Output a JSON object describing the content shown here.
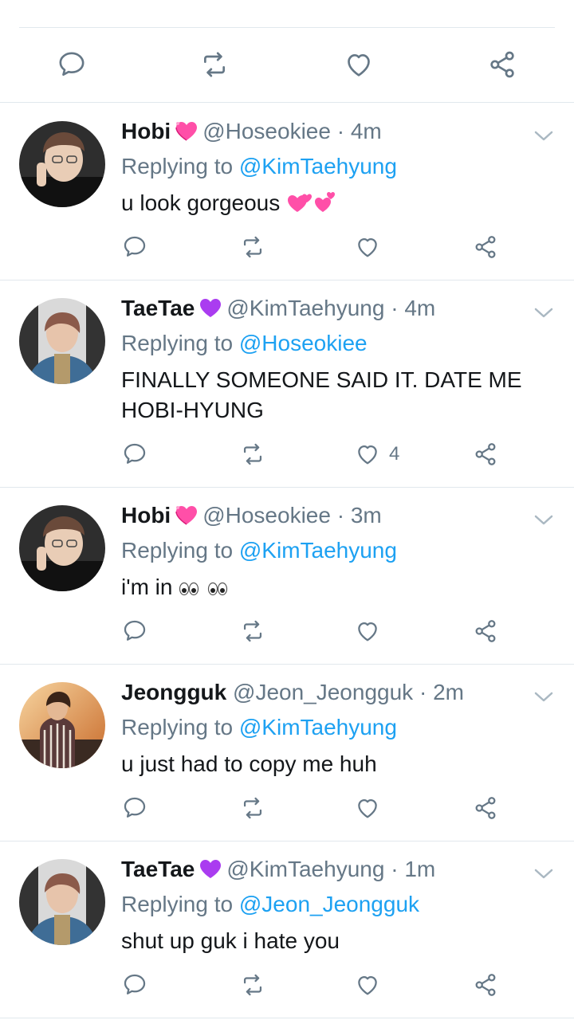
{
  "tweets": [
    {
      "name": "Hobi",
      "name_emoji": "heart-sparkle",
      "handle": "@Hoseokiee",
      "dot": "·",
      "time": "4m",
      "reply_prefix": "Replying to",
      "reply_to": "@KimTaehyung",
      "text": "u look gorgeous",
      "text_emoji": "two-hearts",
      "likes": ""
    },
    {
      "name": "TaeTae",
      "name_emoji": "purple-heart",
      "handle": "@KimTaehyung",
      "dot": "·",
      "time": "4m",
      "reply_prefix": "Replying to",
      "reply_to": "@Hoseokiee",
      "text": "FINALLY SOMEONE SAID IT. DATE ME HOBI-HYUNG",
      "likes": "4"
    },
    {
      "name": "Hobi",
      "name_emoji": "heart-sparkle",
      "handle": "@Hoseokiee",
      "dot": "·",
      "time": "3m",
      "reply_prefix": "Replying to",
      "reply_to": "@KimTaehyung",
      "text": "i'm in",
      "text_emoji": "eyes-x2",
      "likes": ""
    },
    {
      "name": "Jeongguk",
      "handle": "@Jeon_Jeongguk",
      "dot": "·",
      "time": "2m",
      "reply_prefix": "Replying to",
      "reply_to": "@KimTaehyung",
      "text": "u just had to copy me huh",
      "likes": ""
    },
    {
      "name": "TaeTae",
      "name_emoji": "purple-heart",
      "handle": "@KimTaehyung",
      "dot": "·",
      "time": "1m",
      "reply_prefix": "Replying to",
      "reply_to": "@Jeon_Jeongguk",
      "text": "shut up guk i hate you",
      "likes": ""
    }
  ],
  "colors": {
    "link": "#1da1f2",
    "muted": "#657786",
    "icon": "#657786",
    "divider": "#e1e8ed"
  },
  "icons": {
    "reply": "reply-icon",
    "retweet": "retweet-icon",
    "like": "like-icon",
    "share": "share-icon",
    "menu": "chevron-down-icon"
  }
}
